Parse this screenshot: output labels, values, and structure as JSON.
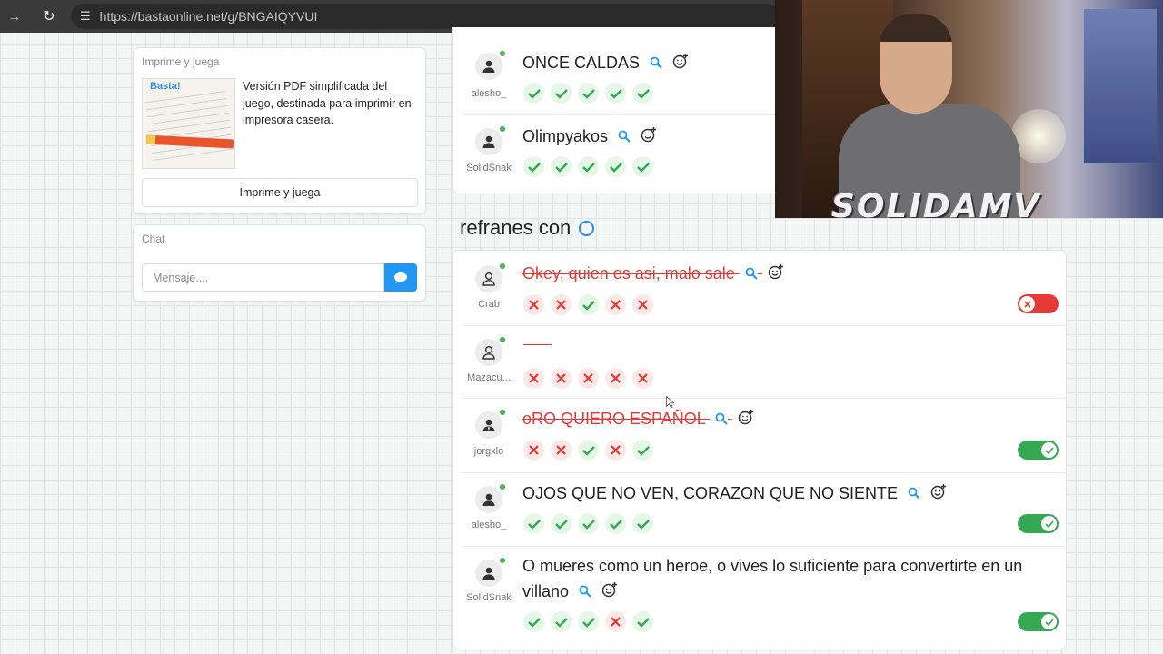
{
  "browser": {
    "url": "https://bastaonline.net/g/BNGAIQYVUI"
  },
  "print_card": {
    "title": "Imprime y juega",
    "image_logo": "Basta!",
    "description": "Versión PDF simplificada del juego, destinada para imprimir en impresora casera.",
    "button_label": "Imprime y juega"
  },
  "chat_card": {
    "title": "Chat",
    "input_placeholder": "Mensaje...."
  },
  "top_answers": [
    {
      "user": "alesho_",
      "answer": "ONCE CALDAS",
      "votes": [
        "ok",
        "ok",
        "ok",
        "ok",
        "ok"
      ]
    },
    {
      "user": "SolidSnak",
      "answer": "Olimpyakos",
      "votes": [
        "ok",
        "ok",
        "ok",
        "ok",
        "ok"
      ]
    }
  ],
  "section": {
    "title": "refranes con"
  },
  "answers": [
    {
      "user": "Crab",
      "answer": "Okey, quien es asi, malo sale",
      "valid": false,
      "has_icons": true,
      "votes": [
        "no",
        "no",
        "ok",
        "no",
        "no"
      ],
      "toggle": "off"
    },
    {
      "user": "Mazacu...",
      "answer": "",
      "valid": false,
      "has_icons": false,
      "votes": [
        "no",
        "no",
        "no",
        "no",
        "no"
      ],
      "toggle": "none"
    },
    {
      "user": "jorgxlo",
      "answer": "oRO QUIERO ESPAÑOL",
      "valid": false,
      "has_icons": true,
      "votes": [
        "no",
        "no",
        "ok",
        "no",
        "ok"
      ],
      "toggle": "on"
    },
    {
      "user": "alesho_",
      "answer": "OJOS QUE NO VEN, CORAZON QUE NO SIENTE",
      "valid": true,
      "has_icons": true,
      "votes": [
        "ok",
        "ok",
        "ok",
        "ok",
        "ok"
      ],
      "toggle": "on"
    },
    {
      "user": "SolidSnak",
      "answer": "O mueres como un heroe, o vives lo suficiente para convertirte en un villano",
      "valid": true,
      "has_icons": true,
      "votes": [
        "ok",
        "ok",
        "ok",
        "no",
        "ok"
      ],
      "toggle": "on"
    }
  ],
  "webcam": {
    "watermark": "SOLIDAMV"
  },
  "colors": {
    "accent": "#2196f3",
    "ok": "#34a853",
    "no": "#e53935"
  }
}
